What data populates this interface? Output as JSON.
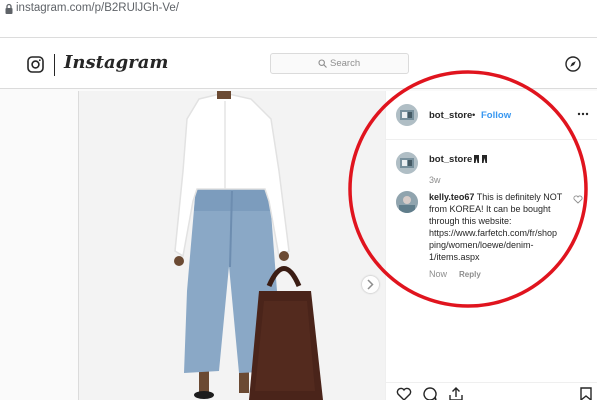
{
  "browser": {
    "url": "instagram.com/p/B2RUlJGh-Ve/"
  },
  "header": {
    "wordmark": "Instagram",
    "search_placeholder": "Search"
  },
  "post": {
    "author": "bot_store",
    "dot": "•",
    "follow_label": "Follow",
    "caption": {
      "user": "bot_store",
      "time": "3w"
    },
    "comment": {
      "user": "kelly.teo67",
      "text": "This is definitely NOT from KOREA! It can be bought through this website: https://www.farfetch.com/fr/shop ping/women/loewe/denim-1/items.aspx",
      "time": "Now",
      "reply_label": "Reply"
    }
  },
  "colors": {
    "link": "#3897f0",
    "annotation": "#e0141e"
  }
}
